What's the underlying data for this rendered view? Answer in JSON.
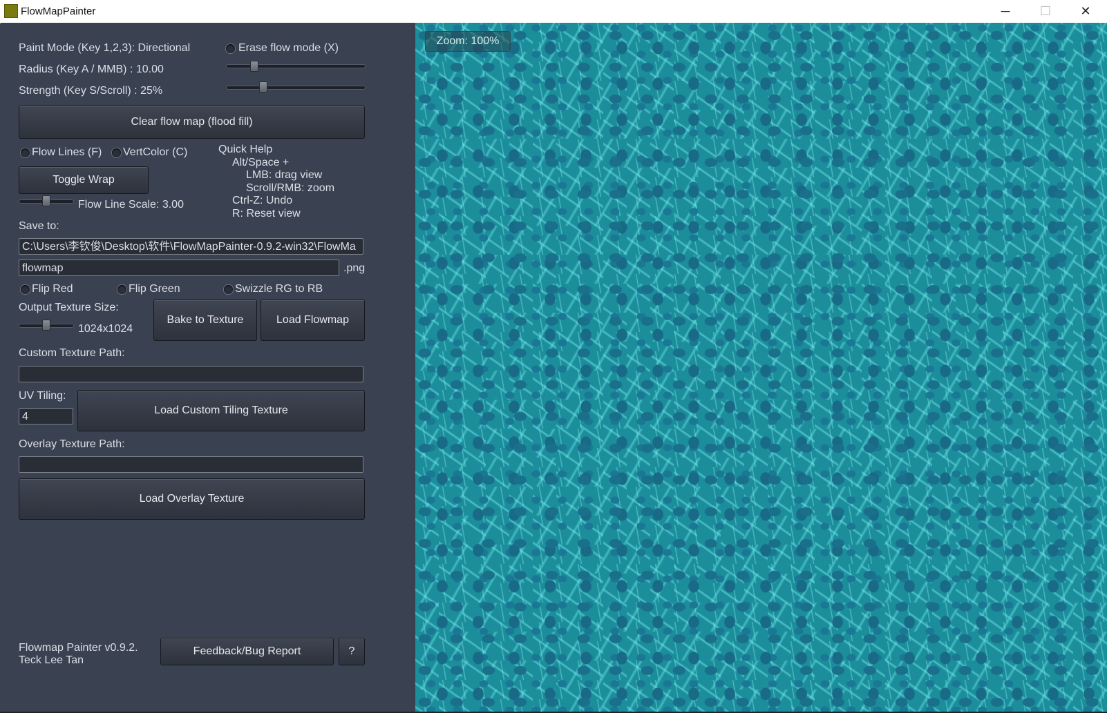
{
  "window": {
    "title": "FlowMapPainter",
    "controls": {
      "minimize": "─",
      "maximize": "☐",
      "close": "✕"
    }
  },
  "panel": {
    "paint_mode": "Paint Mode (Key 1,2,3): Directional",
    "erase_flow": "Erase flow mode (X)",
    "radius": "Radius (Key A / MMB) : 10.00",
    "strength": "Strength (Key S/Scroll) : 25%",
    "clear_button": "Clear flow map (flood fill)",
    "flow_lines": "Flow Lines (F)",
    "vert_color": "VertColor (C)",
    "toggle_wrap": "Toggle Wrap",
    "flow_line_scale": "Flow Line Scale: 3.00",
    "quick_help": {
      "title": "Quick Help",
      "l1": "Alt/Space +",
      "l2": "LMB: drag view",
      "l3": "Scroll/RMB: zoom",
      "l4": "Ctrl-Z: Undo",
      "l5": "R: Reset view"
    },
    "save_to": "Save to:",
    "save_path": "C:\\Users\\李钦俊\\Desktop\\软件\\FlowMapPainter-0.9.2-win32\\FlowMa",
    "file_name": "flowmap",
    "file_ext": ".png",
    "flip_red": "Flip Red",
    "flip_green": "Flip Green",
    "swizzle": "Swizzle RG to RB",
    "output_size_label": "Output Texture Size:",
    "output_size_value": "1024x1024",
    "bake_button": "Bake to Texture",
    "load_flowmap_button": "Load Flowmap",
    "custom_texture_label": "Custom Texture Path:",
    "custom_texture_value": "",
    "uv_tiling_label": "UV Tiling:",
    "uv_tiling_value": "4",
    "load_custom_button": "Load Custom Tiling Texture",
    "overlay_label": "Overlay Texture Path:",
    "overlay_value": "",
    "load_overlay_button": "Load Overlay Texture",
    "version": "Flowmap Painter v0.9.2.",
    "author": "Teck Lee Tan",
    "feedback_button": "Feedback/Bug Report",
    "help_button": "?"
  },
  "sliders": {
    "radius_level": 0.2,
    "strength_level": 0.26,
    "flow_line_scale_level": 0.5,
    "output_size_level": 0.5
  },
  "viewport": {
    "zoom": "Zoom: 100%"
  }
}
